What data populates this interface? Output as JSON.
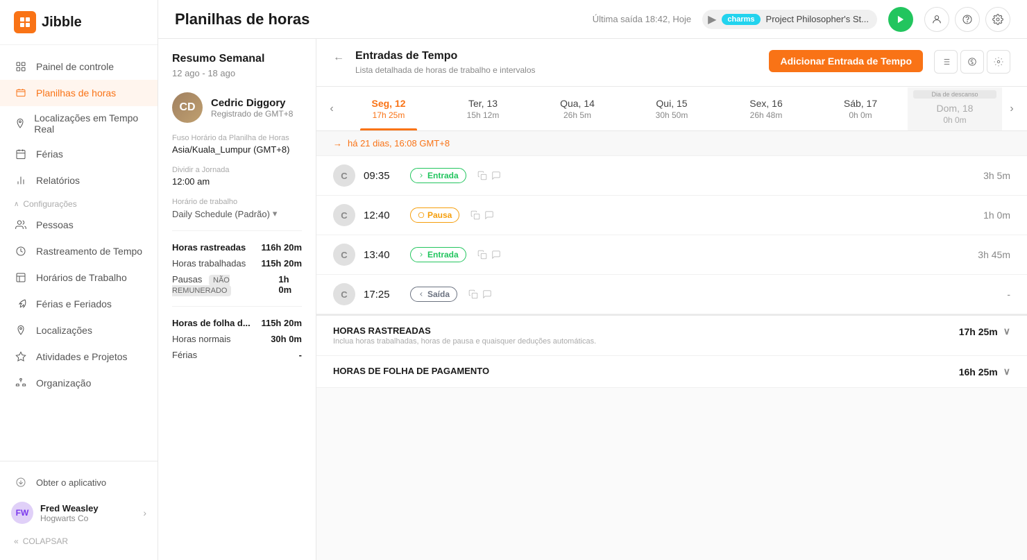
{
  "app": {
    "logo_text": "Jibble",
    "title": "Planilhas de horas"
  },
  "header": {
    "last_exit": "Última saída 18:42, Hoje",
    "tracking_label": "charms",
    "tracking_project": "Project Philosopher's St...",
    "add_entry_btn": "Adicionar Entrada de Tempo"
  },
  "sidebar": {
    "nav_items": [
      {
        "id": "dashboard",
        "label": "Painel de controle",
        "icon": "grid"
      },
      {
        "id": "timesheets",
        "label": "Planilhas de horas",
        "icon": "clock",
        "active": true
      },
      {
        "id": "locations",
        "label": "Localizações em Tempo Real",
        "icon": "location"
      },
      {
        "id": "leaves",
        "label": "Férias",
        "icon": "calendar"
      },
      {
        "id": "reports",
        "label": "Relatórios",
        "icon": "bar-chart"
      }
    ],
    "section_label": "Configurações",
    "config_items": [
      {
        "id": "people",
        "label": "Pessoas",
        "icon": "people"
      },
      {
        "id": "time-tracking",
        "label": "Rastreamento de Tempo",
        "icon": "time-tracking"
      },
      {
        "id": "work-schedules",
        "label": "Horários de Trabalho",
        "icon": "work-schedules"
      },
      {
        "id": "leaves-holidays",
        "label": "Férias e Feriados",
        "icon": "leaves-holidays"
      },
      {
        "id": "locations2",
        "label": "Localizações",
        "icon": "locations2"
      },
      {
        "id": "activities",
        "label": "Atividades e Projetos",
        "icon": "activities"
      },
      {
        "id": "organization",
        "label": "Organização",
        "icon": "organization"
      }
    ],
    "get_app": "Obter o aplicativo",
    "user": {
      "name": "Fred Weasley",
      "company": "Hogwarts Co"
    },
    "collapse": "COLAPSAR"
  },
  "left_panel": {
    "weekly_title": "Resumo Semanal",
    "date_range": "12 ago - 18 ago",
    "employee": {
      "name": "Cedric Diggory",
      "sub": "Registrado de GMT+8"
    },
    "timezone_label": "Fuso Horário da Planilha de Horas",
    "timezone_value": "Asia/Kuala_Lumpur (GMT+8)",
    "split_label": "Dividir a Jornada",
    "split_value": "12:00 am",
    "schedule_label": "Horário de trabalho",
    "schedule_value": "Daily Schedule (Padrão)",
    "tracked_label": "Horas rastreadas",
    "tracked_value": "116h 20m",
    "worked_label": "Horas trabalhadas",
    "worked_value": "115h 20m",
    "breaks_label": "Pausas",
    "breaks_badge": "NÃO REMUNERADO",
    "breaks_value": "1h 0m",
    "payroll_label": "Horas de folha d...",
    "payroll_value": "115h 20m",
    "normal_label": "Horas normais",
    "normal_value": "30h 0m",
    "vacation_label": "Férias",
    "vacation_value": "-"
  },
  "time_entries": {
    "back_arrow": "←",
    "title": "Entradas de Tempo",
    "subtitle": "Lista detalhada de horas de trabalho e intervalos",
    "date_info": "há 21 dias, 16:08 GMT+8",
    "days": [
      {
        "id": "seg12",
        "label": "Seg, 12",
        "hours": "17h 25m",
        "active": true
      },
      {
        "id": "ter13",
        "label": "Ter, 13",
        "hours": "15h 12m",
        "active": false
      },
      {
        "id": "qua14",
        "label": "Qua, 14",
        "hours": "26h 5m",
        "active": false
      },
      {
        "id": "qui15",
        "label": "Qui, 15",
        "hours": "30h 50m",
        "active": false
      },
      {
        "id": "sex16",
        "label": "Sex, 16",
        "hours": "26h 48m",
        "active": false
      },
      {
        "id": "sab17",
        "label": "Sáb, 17",
        "hours": "0h 0m",
        "active": false,
        "rest": false
      },
      {
        "id": "dom18",
        "label": "Dom, 18",
        "hours": "0h 0m",
        "active": false,
        "rest": true
      }
    ],
    "rest_label": "Dia de descanso",
    "entries": [
      {
        "id": 1,
        "avatar": "C",
        "time": "09:35",
        "type": "entrada",
        "label": "Entrada",
        "duration": "3h 5m"
      },
      {
        "id": 2,
        "avatar": "C",
        "time": "12:40",
        "type": "pausa",
        "label": "Pausa",
        "duration": "1h 0m"
      },
      {
        "id": 3,
        "avatar": "C",
        "time": "13:40",
        "type": "entrada",
        "label": "Entrada",
        "duration": "3h 45m"
      },
      {
        "id": 4,
        "avatar": "C",
        "time": "17:25",
        "type": "saida",
        "label": "Saída",
        "duration": "-"
      }
    ],
    "summary": [
      {
        "id": "tracked",
        "title": "HORAS RASTREADAS",
        "subtitle": "Inclua horas trabalhadas, horas de pausa e quaisquer deduções automáticas.",
        "value": "17h 25m"
      },
      {
        "id": "payroll",
        "title": "HORAS DE FOLHA DE PAGAMENTO",
        "subtitle": "",
        "value": "16h 25m"
      }
    ]
  }
}
